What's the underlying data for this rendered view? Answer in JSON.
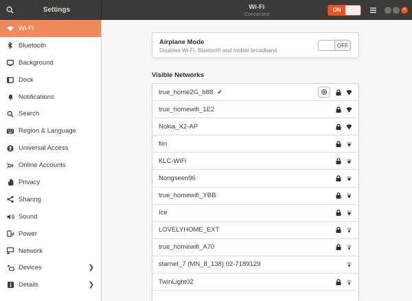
{
  "header": {
    "app_title": "Settings",
    "panel_title": "Wi-Fi",
    "panel_status": "Connected",
    "wifi_switch": "ON"
  },
  "sidebar": {
    "items": [
      {
        "label": "Wi-Fi",
        "icon": "wifi-icon",
        "active": true
      },
      {
        "label": "Bluetooth",
        "icon": "bluetooth-icon"
      },
      {
        "label": "Background",
        "icon": "background-icon"
      },
      {
        "label": "Dock",
        "icon": "dock-icon"
      },
      {
        "label": "Notifications",
        "icon": "bell-icon"
      },
      {
        "label": "Search",
        "icon": "search-icon"
      },
      {
        "label": "Region & Language",
        "icon": "keyboard-icon"
      },
      {
        "label": "Universal Access",
        "icon": "accessibility-icon"
      },
      {
        "label": "Online Accounts",
        "icon": "online-accounts-icon"
      },
      {
        "label": "Privacy",
        "icon": "hand-icon"
      },
      {
        "label": "Sharing",
        "icon": "share-icon"
      },
      {
        "label": "Sound",
        "icon": "speaker-icon"
      },
      {
        "label": "Power",
        "icon": "battery-icon"
      },
      {
        "label": "Network",
        "icon": "network-icon"
      },
      {
        "label": "Devices",
        "icon": "devices-icon",
        "chevron": true
      },
      {
        "label": "Details",
        "icon": "info-icon",
        "chevron": true
      }
    ]
  },
  "airplane": {
    "title": "Airplane Mode",
    "subtitle": "Disables Wi-Fi, Bluetooth and mobile broadband",
    "switch_label": "OFF"
  },
  "networks": {
    "title": "Visible Networks",
    "items": [
      {
        "name": "true_home2G_b88",
        "connected": true,
        "check": "✔",
        "locked": true
      },
      {
        "name": "true_homewifi_1E2",
        "locked": true
      },
      {
        "name": "Nokia_X2-AP",
        "locked": true
      },
      {
        "name": "fiin",
        "locked": true
      },
      {
        "name": "KLC-WiFi",
        "locked": true
      },
      {
        "name": "Nongseen96",
        "locked": true
      },
      {
        "name": "true_homewifi_YBB",
        "locked": true
      },
      {
        "name": "Ice",
        "locked": true
      },
      {
        "name": "LOVELYHOME_EXT",
        "locked": true
      },
      {
        "name": "true_homewifi_A70",
        "locked": true
      },
      {
        "name": "starnet_7 (MN_8_138)  02-7189129",
        "locked": false
      },
      {
        "name": "TwinLight02",
        "locked": true
      }
    ]
  },
  "colors": {
    "accent": "#e95420",
    "sidebar_active": "#f08a5d",
    "headerbar": "#3b3a38"
  }
}
